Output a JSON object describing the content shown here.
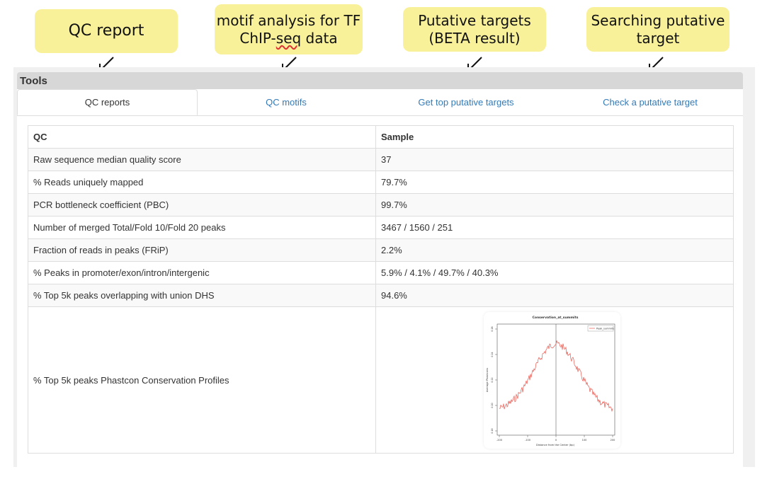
{
  "callouts": {
    "qc": "QC report",
    "motif_line1": "motif analysis for TF",
    "motif_line2_a": "ChIP-",
    "motif_line2_b": "seq",
    "motif_line2_c": " data",
    "targets_line1": "Putative targets",
    "targets_line2": "(BETA result)",
    "search_line1": "Searching putative",
    "search_line2": "target"
  },
  "panel": {
    "title": "Tools"
  },
  "tabs": [
    {
      "label": "QC reports",
      "active": true
    },
    {
      "label": "QC motifs",
      "active": false
    },
    {
      "label": "Get top putative targets",
      "active": false
    },
    {
      "label": "Check a putative target",
      "active": false
    }
  ],
  "table": {
    "headers": [
      "QC",
      "Sample"
    ],
    "rows": [
      [
        "Raw sequence median quality score",
        "37"
      ],
      [
        "% Reads uniquely mapped",
        "79.7%"
      ],
      [
        "PCR bottleneck coefficient (PBC)",
        "99.7%"
      ],
      [
        "Number of merged Total/Fold 10/Fold 20 peaks",
        "3467 / 1560 / 251"
      ],
      [
        "Fraction of reads in peaks (FRiP)",
        "2.2%"
      ],
      [
        "% Peaks in promoter/exon/intron/intergenic",
        "5.9% / 4.1% / 49.7% / 40.3%"
      ],
      [
        "% Top 5k peaks overlapping with union DHS",
        "94.6%"
      ]
    ],
    "plot_row_label": "% Top 5k peaks Phastcon Conservation Profiles"
  },
  "plot": {
    "title": "Conservation_at_summits",
    "legend": "Peak_summits",
    "xlabel": "Distance from the Center (bp)",
    "ylabel": "Average Phastcons",
    "xticks": [
      "-200",
      "-100",
      "0",
      "100",
      "200"
    ],
    "yticks": [
      "0.18",
      "0.20",
      "0.22",
      "0.24",
      "0.26"
    ],
    "line_color": "#e8584f"
  }
}
